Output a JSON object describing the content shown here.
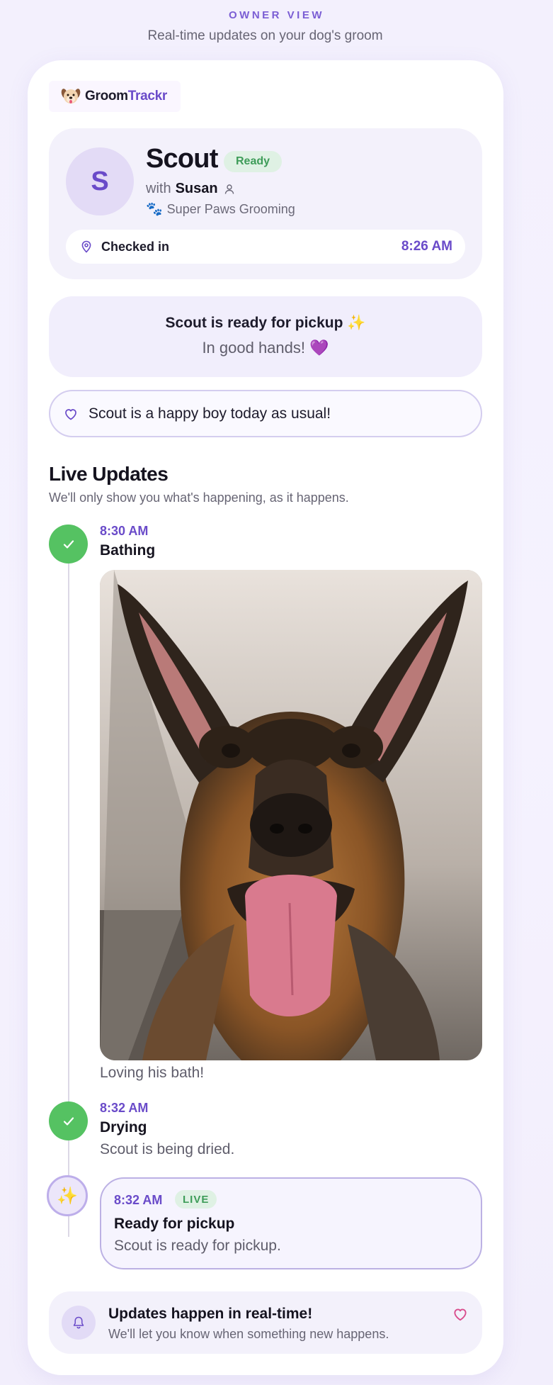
{
  "page": {
    "eyebrow": "OWNER VIEW",
    "tagline": "Real-time updates on your dog's groom"
  },
  "brand": {
    "name_part1": "Groom",
    "name_part2": "Trackr",
    "icon": "dog-face-icon",
    "accent_color": "#6a4bc9"
  },
  "dog": {
    "initial": "S",
    "name": "Scout",
    "status_badge": "Ready",
    "with_label": "with",
    "groomer": "Susan",
    "salon_icon": "🐾",
    "salon": "Super Paws Grooming",
    "checkin_label": "Checked in",
    "checkin_time": "8:26 AM"
  },
  "status": {
    "title": "Scout is ready for pickup",
    "title_emoji": "✨",
    "subtitle": "In good hands!",
    "subtitle_emoji": "💜"
  },
  "note": {
    "icon": "heart-outline-icon",
    "text": "Scout is a happy boy today as usual!"
  },
  "live_updates": {
    "title": "Live Updates",
    "subtitle": "We'll only show you what's happening, as it happens.",
    "steps": [
      {
        "time": "8:30 AM",
        "title": "Bathing",
        "caption": "Loving his bath!",
        "state": "done",
        "has_photo": true
      },
      {
        "time": "8:32 AM",
        "title": "Drying",
        "description": "Scout is being dried.",
        "state": "done"
      },
      {
        "time": "8:32 AM",
        "badge": "LIVE",
        "title": "Ready for pickup",
        "description": "Scout is ready for pickup.",
        "state": "live",
        "icon_emoji": "✨"
      }
    ]
  },
  "footer": {
    "icon": "bell-icon",
    "title": "Updates happen in real-time!",
    "subtitle": "We'll let you know when something new happens.",
    "heart_icon": "heart-outline-icon"
  },
  "colors": {
    "done_green": "#55c262",
    "live_badge_bg": "#dff1e4",
    "live_badge_text": "#3e9c59",
    "heart_pink": "#d94c8c"
  }
}
